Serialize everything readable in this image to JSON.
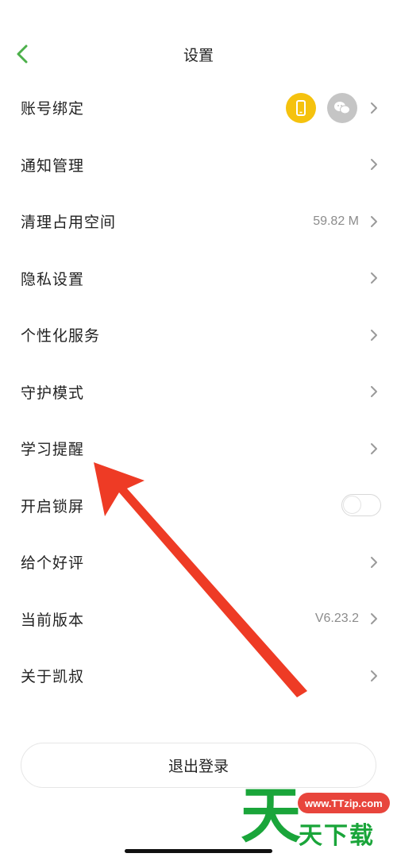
{
  "header": {
    "title": "设置"
  },
  "rows": [
    {
      "label": "账号绑定"
    },
    {
      "label": "通知管理"
    },
    {
      "label": "清理占用空间",
      "value": "59.82 M"
    },
    {
      "label": "隐私设置"
    },
    {
      "label": "个性化服务"
    },
    {
      "label": "守护模式"
    },
    {
      "label": "学习提醒"
    },
    {
      "label": "开启锁屏",
      "toggle_on": false
    },
    {
      "label": "给个好评"
    },
    {
      "label": "当前版本",
      "value": "V6.23.2"
    },
    {
      "label": "关于凯叔"
    }
  ],
  "logout_label": "退出登录",
  "watermark": {
    "url": "www.TTzip.com",
    "big_char": "天",
    "text": "天下载"
  },
  "colors": {
    "accent_green": "#4cb04a",
    "phone_bind": "#f5c20e",
    "wechat_bind": "#c5c5c5",
    "arrow": "#ee3b25",
    "watermark_green": "#1aa53a"
  }
}
